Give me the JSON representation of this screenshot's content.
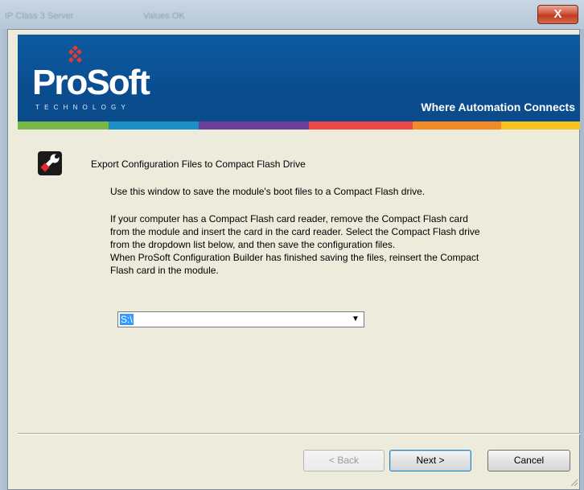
{
  "background_window": {
    "text_left": "IP Class 3 Server",
    "text_right": "Values OK"
  },
  "title_bar": {
    "close_label": "X"
  },
  "banner": {
    "logo_text": "ProSoft",
    "logo_subtitle": "TECHNOLOGY",
    "tagline": "Where Automation Connects",
    "stripe_colors": [
      "#7ab648",
      "#1c8fc5",
      "#6b3f98",
      "#ef4747",
      "#f28b23",
      "#f7c21b"
    ]
  },
  "wizard": {
    "icon": "wrench-icon",
    "title": "Export Configuration Files to Compact Flash Drive",
    "intro": "Use this window to save the module's boot files to a Compact Flash drive.",
    "instructions": [
      "If your computer has a Compact Flash card reader, remove the Compact Flash card",
      "from the module and insert the card in the card reader. Select the Compact Flash drive",
      "from the dropdown list below, and then save the configuration files.",
      "When ProSoft Configuration Builder has finished saving the files, reinsert the Compact",
      "Flash card in the module."
    ],
    "drive_selected": "S:\\"
  },
  "buttons": {
    "back": "< Back",
    "next": "Next >",
    "cancel": "Cancel"
  }
}
